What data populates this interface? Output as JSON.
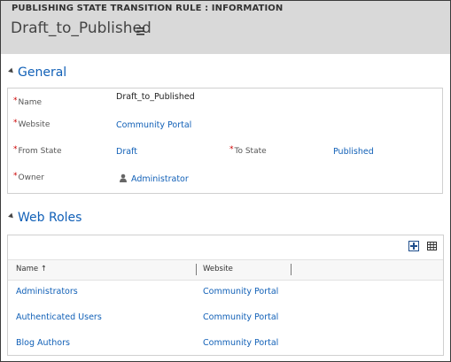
{
  "header": {
    "entity_title": "PUBLISHING STATE TRANSITION RULE : INFORMATION",
    "record_title": "Draft_to_Published"
  },
  "general": {
    "heading": "General",
    "name_label": "Name",
    "name_value": "Draft_to_Published",
    "website_label": "Website",
    "website_value": "Community Portal",
    "from_state_label": "From State",
    "from_state_value": "Draft",
    "to_state_label": "To State",
    "to_state_value": "Published",
    "owner_label": "Owner",
    "owner_value": "Administrator"
  },
  "web_roles": {
    "heading": "Web Roles",
    "columns": [
      "Name",
      "Website"
    ],
    "sort_indicator": "↑",
    "rows": [
      {
        "name": "Administrators",
        "website": "Community Portal"
      },
      {
        "name": "Authenticated Users",
        "website": "Community Portal"
      },
      {
        "name": "Blog Authors",
        "website": "Community Portal"
      }
    ]
  },
  "icons": {
    "menu": "list-menu-icon",
    "owner": "user-icon",
    "add": "add-record-icon",
    "grid": "grid-view-icon"
  },
  "colors": {
    "link": "#1160b7",
    "required": "#cc0000",
    "header_bg": "#d9d9d9"
  }
}
